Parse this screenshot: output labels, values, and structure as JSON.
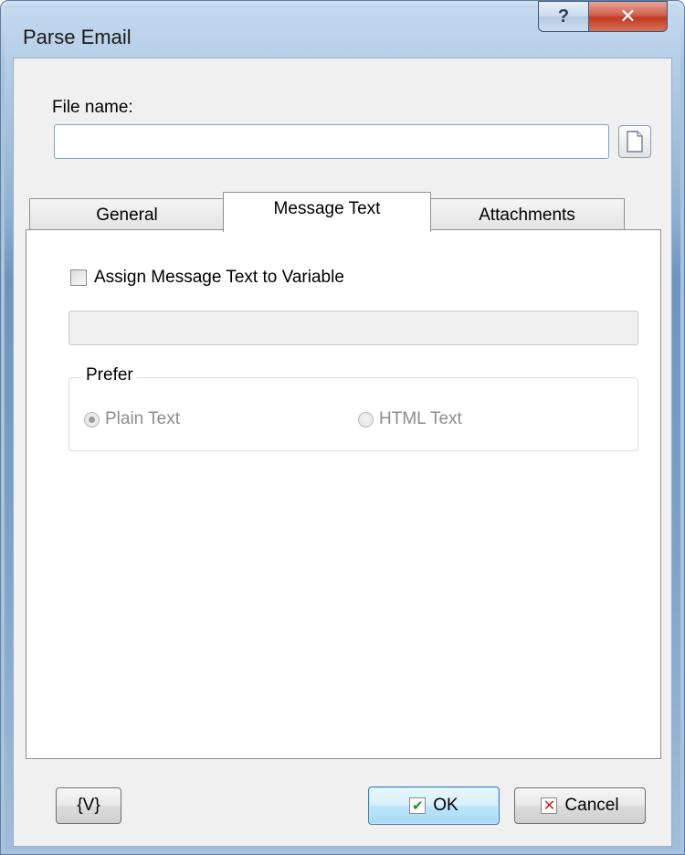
{
  "window": {
    "title": "Parse Email",
    "help_glyph": "?",
    "close_glyph": "✕"
  },
  "file": {
    "label": "File name:",
    "value": "",
    "browse_icon": "document-icon"
  },
  "tabs": [
    {
      "label": "General",
      "selected": false
    },
    {
      "label": "Message Text",
      "selected": true
    },
    {
      "label": "Attachments",
      "selected": false
    }
  ],
  "message_text": {
    "assign_checkbox_label": "Assign Message Text to Variable",
    "assign_checked": false,
    "variable_value": "",
    "prefer_group_label": "Prefer",
    "options": [
      {
        "label": "Plain Text",
        "selected": true,
        "enabled": false
      },
      {
        "label": "HTML Text",
        "selected": false,
        "enabled": false
      }
    ]
  },
  "buttons": {
    "variables_label": "{V}",
    "ok_label": "OK",
    "ok_icon": "check-icon",
    "cancel_label": "Cancel",
    "cancel_icon": "x-icon"
  }
}
